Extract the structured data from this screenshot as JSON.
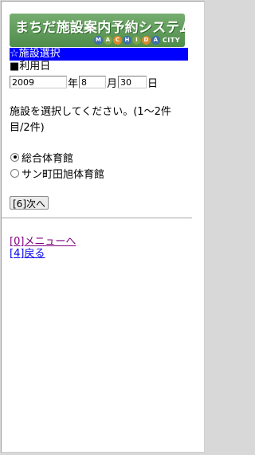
{
  "header": {
    "logo_text": "まちだ施設案内予約システム",
    "logo_sub": [
      "M",
      "A",
      "C",
      "H",
      "I",
      "D",
      "A",
      "CITY"
    ],
    "page_title": "☆施設選択"
  },
  "date": {
    "label": "■利用日",
    "year_value": "2009",
    "year_unit": "年",
    "month_value": "8",
    "month_unit": "月",
    "day_value": "30",
    "day_unit": "日"
  },
  "instructions": {
    "line1": "施設を選択してください。(1～2件",
    "line2": "目/2件)"
  },
  "facilities": [
    {
      "label": "総合体育館",
      "checked": true
    },
    {
      "label": "サン町田旭体育館",
      "checked": false
    }
  ],
  "buttons": {
    "next": "[6]次へ"
  },
  "links": {
    "menu": "[0]メニューへ",
    "back": "[4]戻る"
  },
  "colors": {
    "title_bar": "#0000ff",
    "logo_green": "#5c9a57",
    "visited_link": "#800080",
    "link": "#0000ee"
  }
}
